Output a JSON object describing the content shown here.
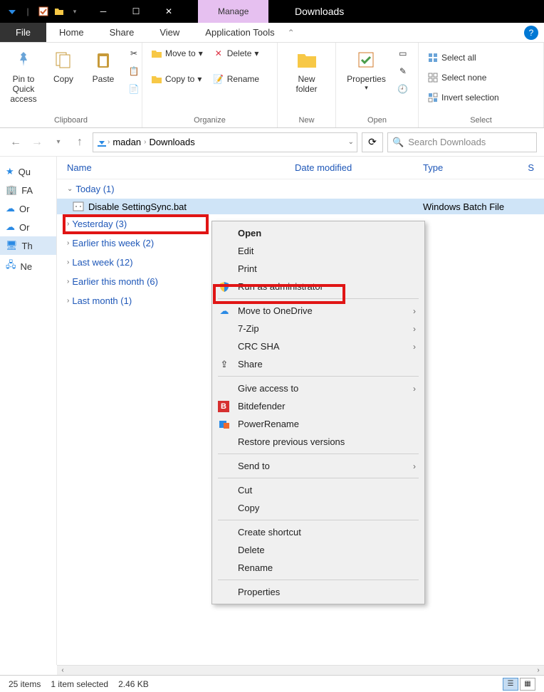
{
  "window": {
    "manage_tab": "Manage",
    "title": "Downloads"
  },
  "ribbon_tabs": {
    "file": "File",
    "home": "Home",
    "share": "Share",
    "view": "View",
    "app_tools": "Application Tools"
  },
  "ribbon": {
    "clipboard": {
      "label": "Clipboard",
      "pin": "Pin to Quick access",
      "copy": "Copy",
      "paste": "Paste"
    },
    "organize": {
      "label": "Organize",
      "moveto": "Move to",
      "copyto": "Copy to",
      "delete": "Delete",
      "rename": "Rename"
    },
    "new": {
      "label": "New",
      "newfolder": "New folder"
    },
    "open": {
      "label": "Open",
      "properties": "Properties"
    },
    "select": {
      "label": "Select",
      "all": "Select all",
      "none": "Select none",
      "invert": "Invert selection"
    }
  },
  "address": {
    "seg1": "madan",
    "seg2": "Downloads"
  },
  "search": {
    "placeholder": "Search Downloads"
  },
  "columns": {
    "name": "Name",
    "date": "Date modified",
    "type": "Type",
    "s": "S"
  },
  "tree": {
    "i0": "Qu",
    "i1": "FA",
    "i2": "Or",
    "i3": "Or",
    "i4": "Th",
    "i5": "Ne"
  },
  "groups": {
    "today": "Today (1)",
    "yesterday": "Yesterday (3)",
    "thisweek": "Earlier this week (2)",
    "lastweek": "Last week (12)",
    "thismonth": "Earlier this month (6)",
    "lastmonth": "Last month (1)"
  },
  "file": {
    "name": "Disable SettingSync.bat",
    "type": "Windows Batch File"
  },
  "ctx": {
    "open": "Open",
    "edit": "Edit",
    "print": "Print",
    "runadmin": "Run as administrator",
    "onedrive": "Move to OneDrive",
    "sevenzip": "7-Zip",
    "crcsha": "CRC SHA",
    "share": "Share",
    "giveaccess": "Give access to",
    "bitdefender": "Bitdefender",
    "powerrename": "PowerRename",
    "restore": "Restore previous versions",
    "sendto": "Send to",
    "cut": "Cut",
    "copy": "Copy",
    "shortcut": "Create shortcut",
    "delete": "Delete",
    "rename": "Rename",
    "properties": "Properties"
  },
  "status": {
    "count": "25 items",
    "selected": "1 item selected",
    "size": "2.46 KB"
  }
}
